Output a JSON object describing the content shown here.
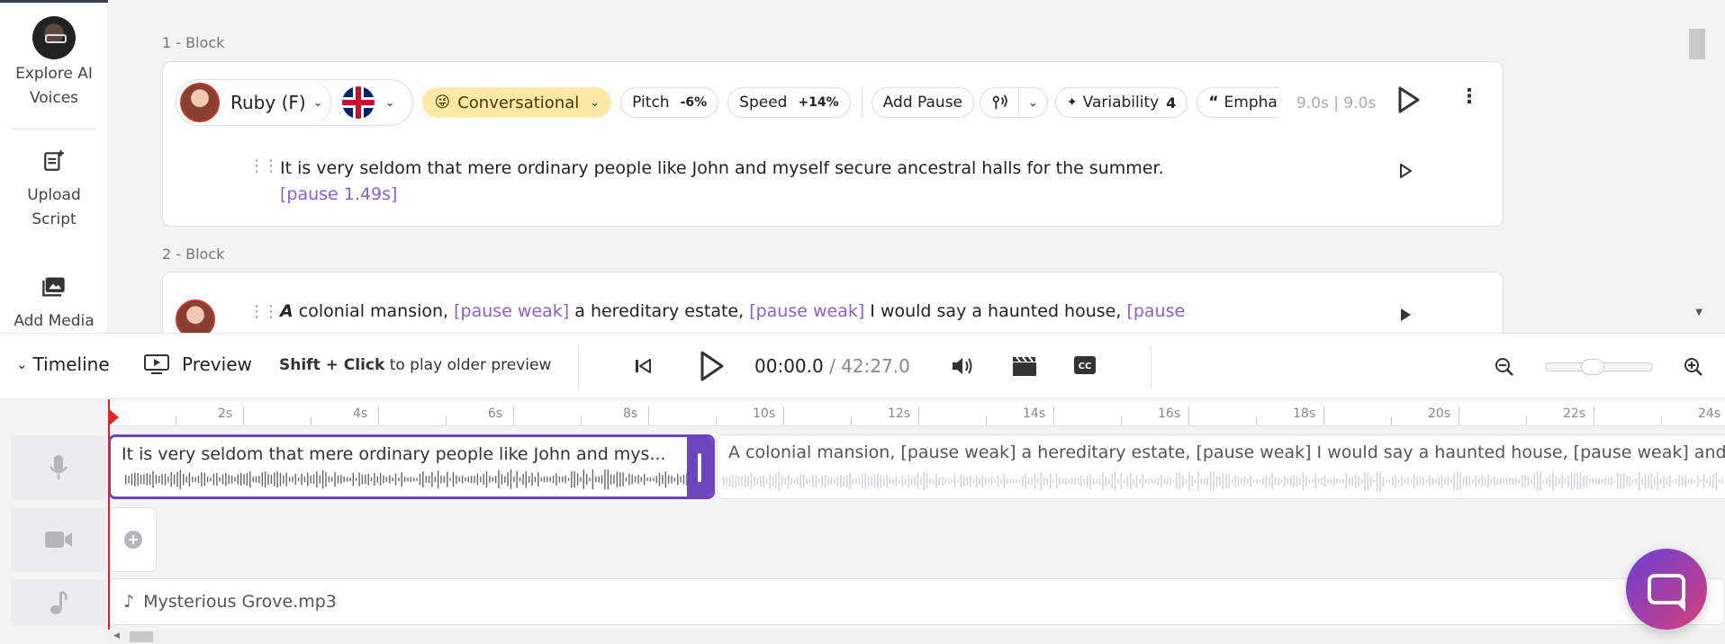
{
  "sidebar": {
    "items": [
      {
        "label": "Explore AI Voices",
        "icon": "user-avatar"
      },
      {
        "label": "Upload Script",
        "icon": "upload-script-icon"
      },
      {
        "label": "Add Media",
        "icon": "add-media-icon"
      }
    ]
  },
  "blocks": [
    {
      "label": "1 -  Block",
      "voice": "Ruby (F)",
      "style": "Conversational",
      "style_emoji": "😜",
      "pitch_label": "Pitch",
      "pitch_value": "-6%",
      "speed_label": "Speed",
      "speed_value": "+14%",
      "add_pause": "Add Pause",
      "variability_label": "Variability",
      "variability_value": "4",
      "emphasis_label": "Empha",
      "duration": "9.0s | 9.0s",
      "text": "It is very seldom that mere ordinary people like John and myself secure ancestral halls for the summer.",
      "pause": "[pause 1.49s]"
    },
    {
      "label": "2 -  Block",
      "text_em": "A",
      "text_1": " colonial mansion, ",
      "pause_1": "[pause weak]",
      "text_2": " a hereditary estate, ",
      "pause_2": "[pause weak]",
      "text_3": " I would say a haunted house, ",
      "pause_3": "[pause"
    }
  ],
  "transport": {
    "timeline_label": "Timeline",
    "preview_label": "Preview",
    "hint_bold": "Shift + Click",
    "hint_rest": " to play older preview",
    "current_time": "00:00.0",
    "total_time": " / 42:27.0"
  },
  "ruler": {
    "labels": [
      "2s",
      "4s",
      "6s",
      "8s",
      "10s",
      "12s",
      "14s",
      "16s",
      "18s",
      "20s",
      "22s",
      "24s"
    ]
  },
  "tracks": {
    "clip1_text": "It is very seldom that mere ordinary people like John and mys...",
    "clip2_text": "A colonial mansion, [pause weak] a hereditary estate, [pause weak] I would say a haunted house, [pause weak] and",
    "music_file": "Mysterious Grove.mp3"
  },
  "colors": {
    "accent": "#6b46c1",
    "pause_tag": "#8a5fd6",
    "playhead": "#e0202a",
    "style_chip": "#fde9a6"
  }
}
